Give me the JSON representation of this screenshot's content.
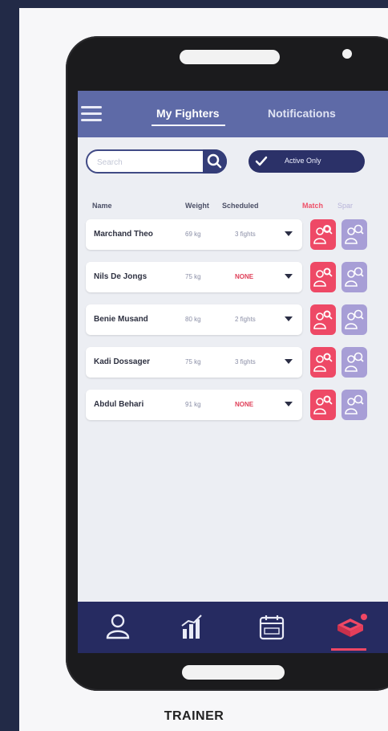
{
  "tabs": {
    "my_fighters": "My Fighters",
    "notifications": "Notifications"
  },
  "search": {
    "placeholder": "Search"
  },
  "toggle": {
    "label": "Active Only"
  },
  "columns": {
    "name": "Name",
    "weight": "Weight",
    "scheduled": "Scheduled",
    "match": "Match",
    "spar": "Spar"
  },
  "fighters": [
    {
      "name": "Marchand Theo",
      "weight": "69 kg",
      "scheduled": "3 fights"
    },
    {
      "name": "Nils De Jongs",
      "weight": "75 kg",
      "scheduled": "NONE"
    },
    {
      "name": "Benie Musand",
      "weight": "80 kg",
      "scheduled": "2 fights"
    },
    {
      "name": "Kadi Dossager",
      "weight": "75 kg",
      "scheduled": "3 fights"
    },
    {
      "name": "Abdul Behari",
      "weight": "91 kg",
      "scheduled": "NONE"
    }
  ],
  "nav_icons": [
    "profile-icon",
    "stats-icon",
    "calendar-icon",
    "ring-icon"
  ],
  "caption": "TRAINER",
  "colors": {
    "topbar": "#5e6aa7",
    "navbar": "#262b61",
    "match": "#ee4966",
    "spar": "#a79ed6",
    "none_status": "#e04059"
  }
}
